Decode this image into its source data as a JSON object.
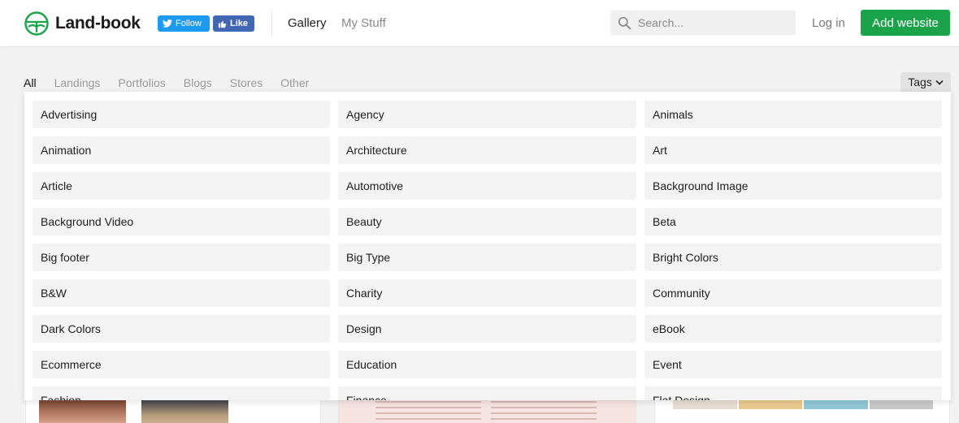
{
  "header": {
    "brand": "Land-book",
    "follow_label": "Follow",
    "like_label": "Like",
    "nav": [
      "Gallery",
      "My Stuff"
    ],
    "search_placeholder": "Search...",
    "login_label": "Log in",
    "add_label": "Add website"
  },
  "filters": {
    "categories": [
      "All",
      "Landings",
      "Portfolios",
      "Blogs",
      "Stores",
      "Other"
    ],
    "active": "All",
    "tags_label": "Tags"
  },
  "tags": [
    "Advertising",
    "Agency",
    "Animals",
    "Animation",
    "Architecture",
    "Art",
    "Article",
    "Automotive",
    "Background Image",
    "Background Video",
    "Beauty",
    "Beta",
    "Big footer",
    "Big Type",
    "Bright Colors",
    "B&W",
    "Charity",
    "Community",
    "Dark Colors",
    "Design",
    "eBook",
    "Ecommerce",
    "Education",
    "Event",
    "Fashion",
    "Finance",
    "Flat Design"
  ],
  "colors": {
    "accent_green": "#1aa34a",
    "twitter_blue": "#1d9bf0",
    "facebook_blue": "#4267b2"
  },
  "icons": [
    "logo-mark-icon",
    "twitter-bird-icon",
    "thumbs-up-icon",
    "search-icon",
    "chevron-down-icon"
  ]
}
